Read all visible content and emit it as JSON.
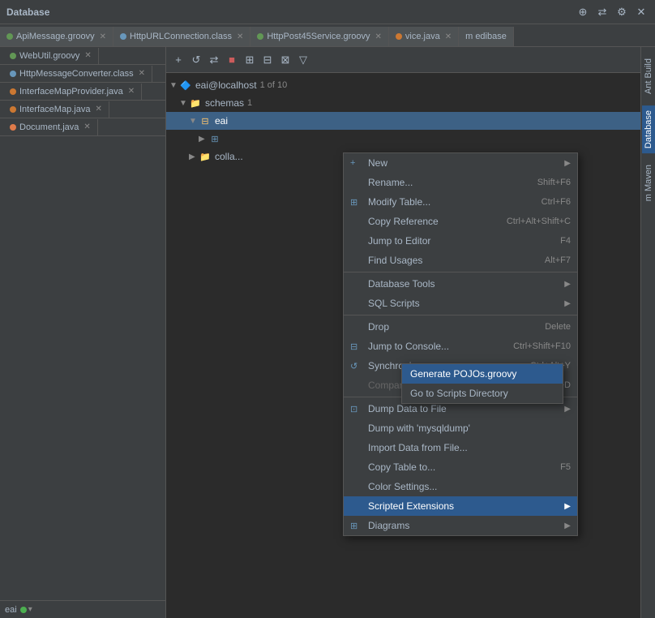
{
  "topbar": {
    "title": "Database",
    "icons": [
      "+",
      "⊕",
      "⋯",
      "✕"
    ]
  },
  "tabs": [
    {
      "label": "ApiMessage.groovy",
      "type": "groovy",
      "active": false
    },
    {
      "label": "HttpURLConnection.class",
      "type": "class",
      "active": false
    },
    {
      "label": "HttpPost45Service.groovy",
      "type": "groovy",
      "active": false
    },
    {
      "label": "vice.java",
      "type": "java",
      "active": false
    },
    {
      "label": "m edibase",
      "type": "other",
      "active": false
    },
    {
      "label": "WebUtil.groovy",
      "type": "groovy",
      "active": false
    },
    {
      "label": "HttpMessageConverter.class",
      "type": "class",
      "active": false
    },
    {
      "label": "InterfaceMapProvider.java",
      "type": "java",
      "active": false
    },
    {
      "label": "InterfaceMap.java",
      "type": "java",
      "active": false
    },
    {
      "label": "Document.java",
      "type": "java",
      "active": false
    }
  ],
  "db_toolbar_buttons": [
    "+",
    "⊕",
    "↺",
    "⇄",
    "■",
    "⊞",
    "⊟",
    "⊠",
    "▽"
  ],
  "tree": {
    "connection": "eai@localhost",
    "of_text": "1 of 10",
    "schemas_label": "schemas",
    "schemas_count": "1",
    "schema_name": "eai",
    "table_name": "■",
    "collapsed_label": "colla..."
  },
  "context_menu": {
    "items": [
      {
        "label": "New",
        "shortcut": "",
        "has_arrow": true,
        "icon": "+",
        "separator_after": false
      },
      {
        "label": "Rename...",
        "shortcut": "Shift+F6",
        "has_arrow": false,
        "icon": "",
        "separator_after": false
      },
      {
        "label": "Modify Table...",
        "shortcut": "Ctrl+F6",
        "has_arrow": false,
        "icon": "⊞",
        "separator_after": false
      },
      {
        "label": "Copy Reference",
        "shortcut": "Ctrl+Alt+Shift+C",
        "has_arrow": false,
        "icon": "",
        "separator_after": false
      },
      {
        "label": "Jump to Editor",
        "shortcut": "F4",
        "has_arrow": false,
        "icon": "",
        "separator_after": false
      },
      {
        "label": "Find Usages",
        "shortcut": "Alt+F7",
        "has_arrow": false,
        "icon": "",
        "separator_after": true
      },
      {
        "label": "Database Tools",
        "shortcut": "",
        "has_arrow": true,
        "icon": "",
        "separator_after": false
      },
      {
        "label": "SQL Scripts",
        "shortcut": "",
        "has_arrow": true,
        "icon": "",
        "separator_after": true
      },
      {
        "label": "Drop",
        "shortcut": "Delete",
        "has_arrow": false,
        "icon": "",
        "separator_after": false
      },
      {
        "label": "Jump to Console...",
        "shortcut": "Ctrl+Shift+F10",
        "has_arrow": false,
        "icon": "⊟",
        "separator_after": false
      },
      {
        "label": "Synchronize",
        "shortcut": "Ctrl+Alt+Y",
        "has_arrow": false,
        "icon": "↺",
        "separator_after": false
      },
      {
        "label": "Compare",
        "shortcut": "Ctrl+D",
        "has_arrow": false,
        "icon": "",
        "disabled": true,
        "separator_after": true
      },
      {
        "label": "Dump Data to File",
        "shortcut": "",
        "has_arrow": true,
        "icon": "⊡",
        "separator_after": false
      },
      {
        "label": "Dump with 'mysqldump'",
        "shortcut": "",
        "has_arrow": false,
        "icon": "",
        "separator_after": false
      },
      {
        "label": "Import Data from File...",
        "shortcut": "",
        "has_arrow": false,
        "icon": "",
        "separator_after": false
      },
      {
        "label": "Copy Table to...",
        "shortcut": "F5",
        "has_arrow": false,
        "icon": "",
        "separator_after": false
      },
      {
        "label": "Color Settings...",
        "shortcut": "",
        "has_arrow": false,
        "icon": "",
        "separator_after": false
      },
      {
        "label": "Scripted Extensions",
        "shortcut": "",
        "has_arrow": true,
        "icon": "",
        "highlighted": true,
        "separator_after": false
      },
      {
        "label": "Diagrams",
        "shortcut": "",
        "has_arrow": true,
        "icon": "⊞",
        "separator_after": false
      }
    ]
  },
  "submenu": {
    "items": [
      {
        "label": "Generate POJOs.groovy",
        "highlighted": true
      },
      {
        "label": "Go to Scripts Directory",
        "highlighted": false
      }
    ]
  },
  "db_status": {
    "text": "eai",
    "has_green_dot": true
  },
  "vertical_tabs": [
    "Ant Build",
    "Database",
    "m Maven"
  ]
}
